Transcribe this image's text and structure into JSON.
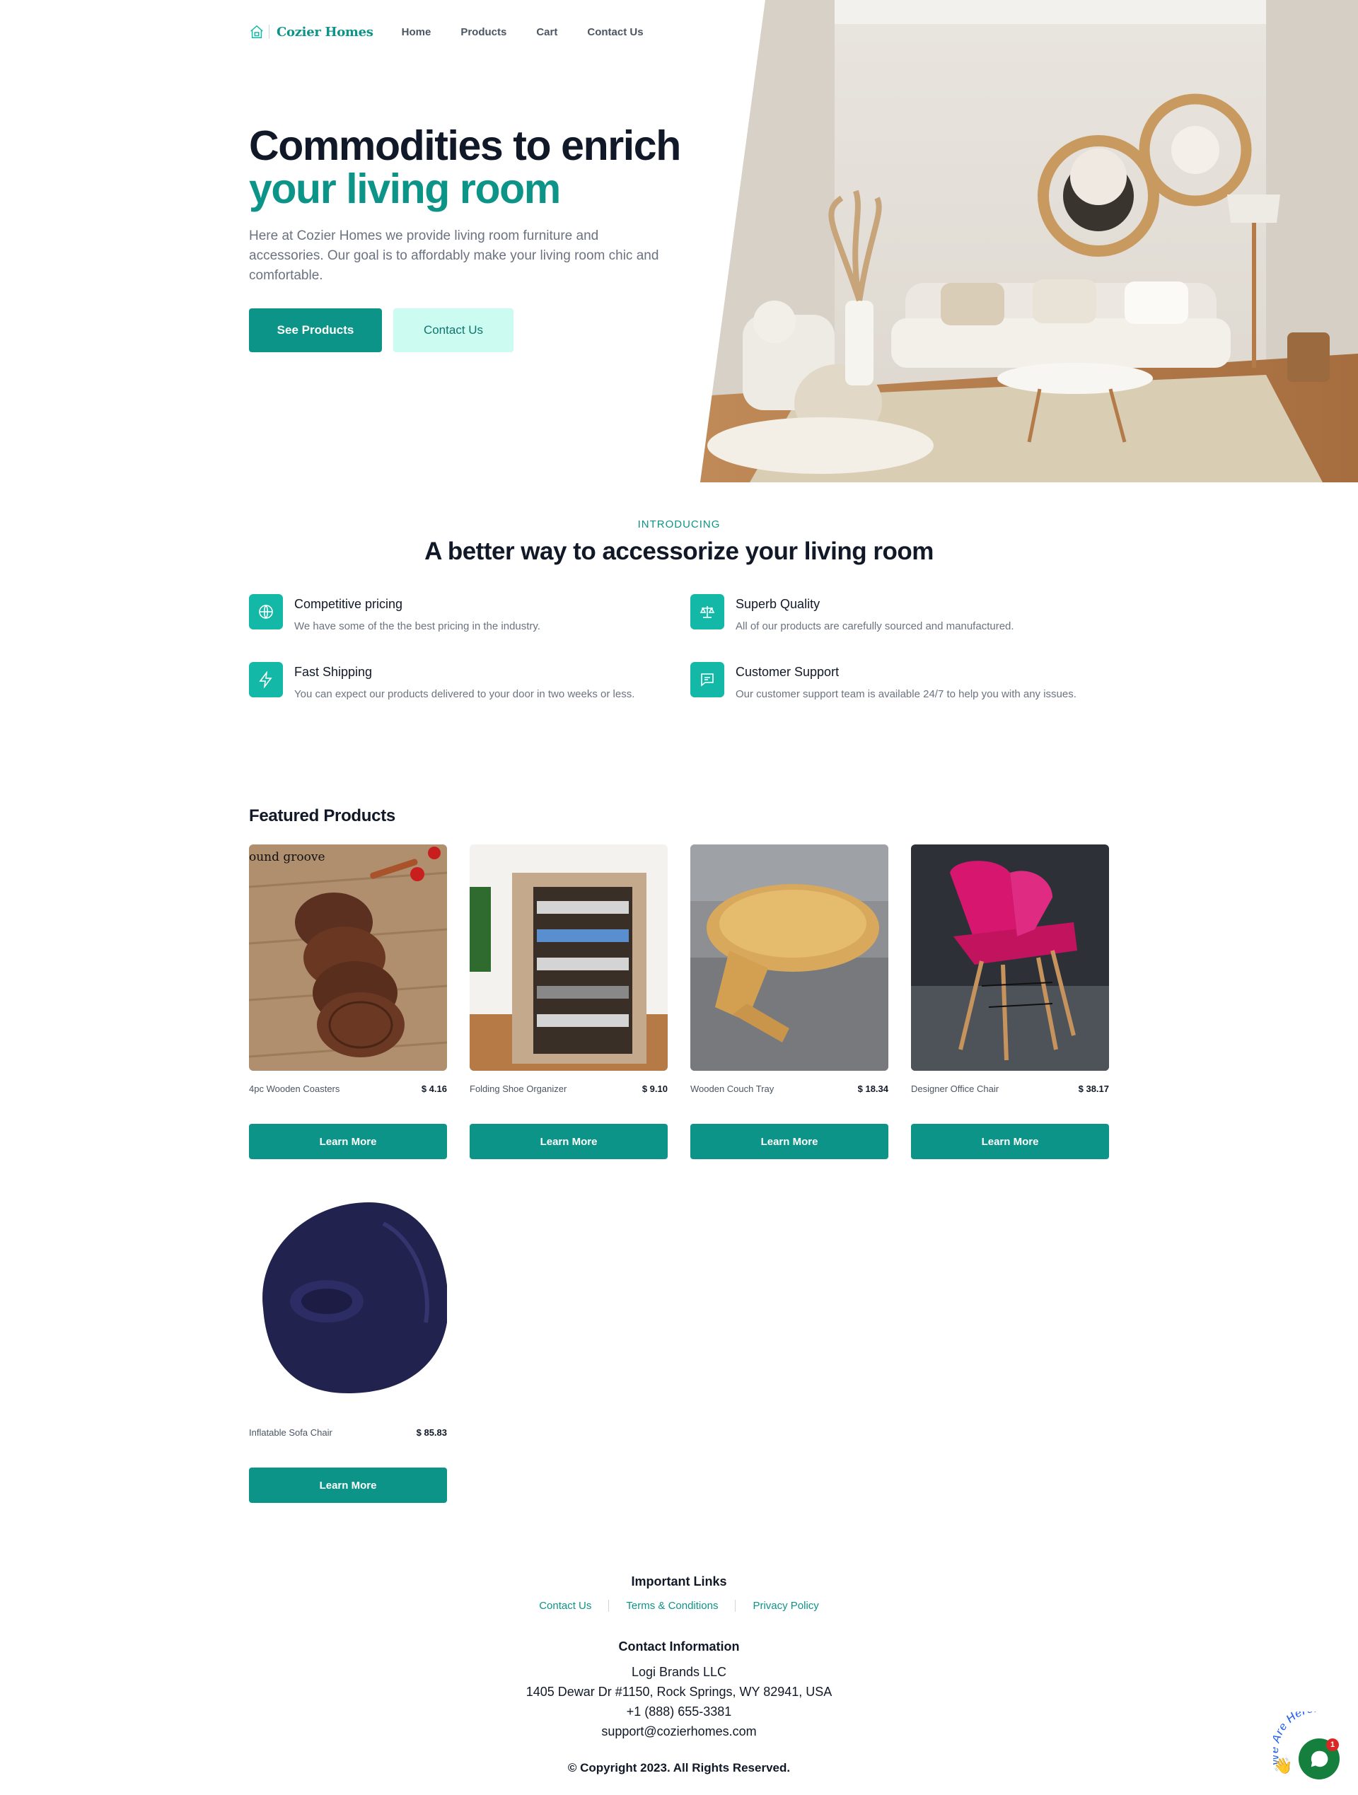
{
  "nav": {
    "brand": "Cozier Homes",
    "links": [
      "Home",
      "Products",
      "Cart",
      "Contact Us"
    ]
  },
  "hero": {
    "title_part1": "Commodities to enrich ",
    "title_accent": "your living room",
    "description": "Here at Cozier Homes we provide living room furniture and accessories. Our goal is to affordably make your living room chic and comfortable.",
    "primary_button": "See Products",
    "secondary_button": "Contact Us"
  },
  "intro": {
    "eyebrow": "INTRODUCING",
    "title": "A better way to accessorize your living room",
    "features": [
      {
        "title": "Competitive pricing",
        "desc": "We have some of the the best pricing in the industry.",
        "icon": "globe-icon"
      },
      {
        "title": "Superb Quality",
        "desc": "All of our products are carefully sourced and manufactured.",
        "icon": "scale-icon"
      },
      {
        "title": "Fast Shipping",
        "desc": "You can expect our products delivered to your door in two weeks or less.",
        "icon": "lightning-icon"
      },
      {
        "title": "Customer Support",
        "desc": "Our customer support team is available 24/7 to help you with any issues.",
        "icon": "chat-icon"
      }
    ]
  },
  "products": {
    "title": "Featured Products",
    "button_label": "Learn More",
    "items": [
      {
        "name": "4pc Wooden Coasters",
        "price": "$ 4.16",
        "image_caption": "ound groove"
      },
      {
        "name": "Folding Shoe Organizer",
        "price": "$ 9.10"
      },
      {
        "name": "Wooden Couch Tray",
        "price": "$ 18.34"
      },
      {
        "name": "Designer Office Chair",
        "price": "$ 38.17"
      },
      {
        "name": "Inflatable Sofa Chair",
        "price": "$ 85.83"
      }
    ]
  },
  "footer": {
    "links_title": "Important Links",
    "links": [
      "Contact Us",
      "Terms & Conditions",
      "Privacy Policy"
    ],
    "contact_title": "Contact Information",
    "company": "Logi Brands LLC",
    "address": "1405 Dewar Dr #1150, Rock Springs, WY 82941, USA",
    "phone": "+1 (888) 655-3381",
    "email": "support@cozierhomes.com",
    "copyright": "© Copyright 2023. All Rights Reserved."
  },
  "chat": {
    "badge_text": "We Are Here!",
    "unread_count": "1"
  },
  "colors": {
    "accent": "#0d9488",
    "accent_soft": "#ccfbf1",
    "feature_icon_bg": "#14b8a6",
    "chat_green": "#15803d"
  }
}
